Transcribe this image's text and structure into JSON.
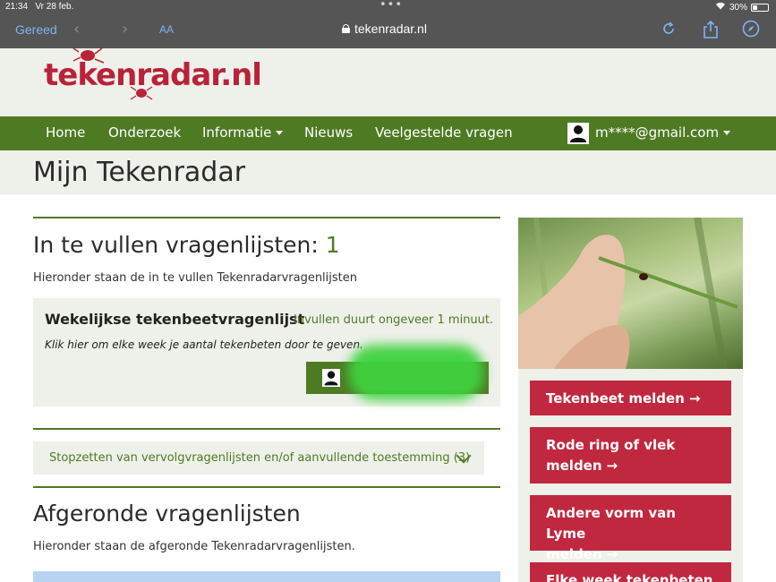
{
  "status": {
    "time": "21:34",
    "date": "Vr 28 feb.",
    "battery": "30%"
  },
  "safari": {
    "done_label": "Gereed",
    "text_size_label": "AA",
    "url": "tekenradar.nl"
  },
  "site": {
    "logo_text": "tekenradar.nl"
  },
  "nav": {
    "items": [
      "Home",
      "Onderzoek",
      "Informatie",
      "Nieuws",
      "Veelgestelde vragen"
    ],
    "user_email": "m****@gmail.com"
  },
  "page": {
    "title": "Mijn Tekenradar"
  },
  "todo": {
    "heading": "In te vullen vragenlijsten: ",
    "count": "1",
    "subtitle": "Hieronder staan de in te vullen Tekenradarvragenlijsten",
    "card": {
      "title": "Wekelijkse tekenbeetvragenlijst",
      "duration": "Invullen duurt ongeveer 1 minuut.",
      "description": "Klik hier om elke week je aantal tekenbeten door te geven."
    }
  },
  "stop": {
    "label": "Stopzetten van vervolgvragenlijsten en/of aanvullende toestemming (3)"
  },
  "done": {
    "heading": "Afgeronde vragenlijsten",
    "subtitle": "Hieronder staan de afgeronde Tekenradarvragenlijsten."
  },
  "sidebar": {
    "buttons": [
      {
        "line1": "Tekenbeet melden",
        "line2": ""
      },
      {
        "line1": "Rode ring of vlek",
        "line2": "melden"
      },
      {
        "line1": "Andere vorm van Lyme",
        "line2": "melden"
      },
      {
        "line1": "Elke week tekenbeten",
        "line2": ""
      }
    ]
  },
  "colors": {
    "brand_green": "#4f7a24",
    "brand_red": "#c0283f",
    "panel_bg": "#eef0ea"
  }
}
